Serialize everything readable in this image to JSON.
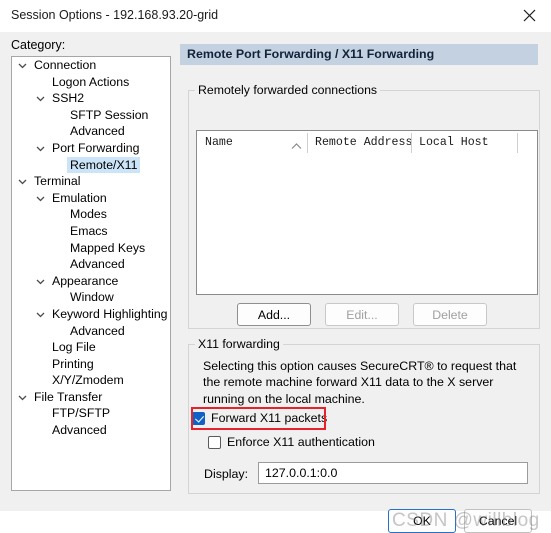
{
  "window": {
    "title": "Session Options - 192.168.93.20-grid",
    "close_icon": "close-icon"
  },
  "category": {
    "label": "Category:",
    "items": [
      {
        "label": "Connection",
        "indent": 0,
        "expander": "chevron-down",
        "selected": false
      },
      {
        "label": "Logon Actions",
        "indent": 1,
        "expander": "none",
        "selected": false
      },
      {
        "label": "SSH2",
        "indent": 1,
        "expander": "chevron-down",
        "selected": false
      },
      {
        "label": "SFTP Session",
        "indent": 2,
        "expander": "none",
        "selected": false
      },
      {
        "label": "Advanced",
        "indent": 2,
        "expander": "none",
        "selected": false
      },
      {
        "label": "Port Forwarding",
        "indent": 1,
        "expander": "chevron-down",
        "selected": false
      },
      {
        "label": "Remote/X11",
        "indent": 2,
        "expander": "none",
        "selected": true
      },
      {
        "label": "Terminal",
        "indent": 0,
        "expander": "chevron-down",
        "selected": false
      },
      {
        "label": "Emulation",
        "indent": 1,
        "expander": "chevron-down",
        "selected": false
      },
      {
        "label": "Modes",
        "indent": 2,
        "expander": "none",
        "selected": false
      },
      {
        "label": "Emacs",
        "indent": 2,
        "expander": "none",
        "selected": false
      },
      {
        "label": "Mapped Keys",
        "indent": 2,
        "expander": "none",
        "selected": false
      },
      {
        "label": "Advanced",
        "indent": 2,
        "expander": "none",
        "selected": false
      },
      {
        "label": "Appearance",
        "indent": 1,
        "expander": "chevron-down",
        "selected": false
      },
      {
        "label": "Window",
        "indent": 2,
        "expander": "none",
        "selected": false
      },
      {
        "label": "Keyword Highlighting",
        "indent": 1,
        "expander": "chevron-down",
        "selected": false
      },
      {
        "label": "Advanced",
        "indent": 2,
        "expander": "none",
        "selected": false
      },
      {
        "label": "Log File",
        "indent": 1,
        "expander": "none",
        "selected": false
      },
      {
        "label": "Printing",
        "indent": 1,
        "expander": "none",
        "selected": false
      },
      {
        "label": "X/Y/Zmodem",
        "indent": 1,
        "expander": "none",
        "selected": false
      },
      {
        "label": "File Transfer",
        "indent": 0,
        "expander": "chevron-down",
        "selected": false
      },
      {
        "label": "FTP/SFTP",
        "indent": 1,
        "expander": "none",
        "selected": false
      },
      {
        "label": "Advanced",
        "indent": 1,
        "expander": "none",
        "selected": false
      }
    ]
  },
  "main": {
    "section_header": "Remote Port Forwarding / X11 Forwarding",
    "forwarded": {
      "legend": "Remotely forwarded connections",
      "columns": [
        "Name",
        "Remote Address",
        "Local Host"
      ],
      "sort_column": "Name",
      "sort_icon": "sort-ascending-icon",
      "rows": [],
      "buttons": {
        "add": "Add...",
        "edit": "Edit...",
        "delete": "Delete"
      }
    },
    "x11": {
      "legend": "X11 forwarding",
      "description": "Selecting this option causes SecureCRT® to request that the remote machine forward X11 data to the X server running on the local machine.",
      "forward_packets_label": "Forward X11 packets",
      "forward_packets_checked": true,
      "enforce_auth_label": "Enforce X11 authentication",
      "enforce_auth_checked": false,
      "display_label": "Display:",
      "display_value": "127.0.0.1:0.0",
      "highlight_color": "#e8222a"
    }
  },
  "footer": {
    "ok": "OK",
    "cancel": "Cancel"
  },
  "watermark": {
    "text": "CSDN @willblog"
  }
}
